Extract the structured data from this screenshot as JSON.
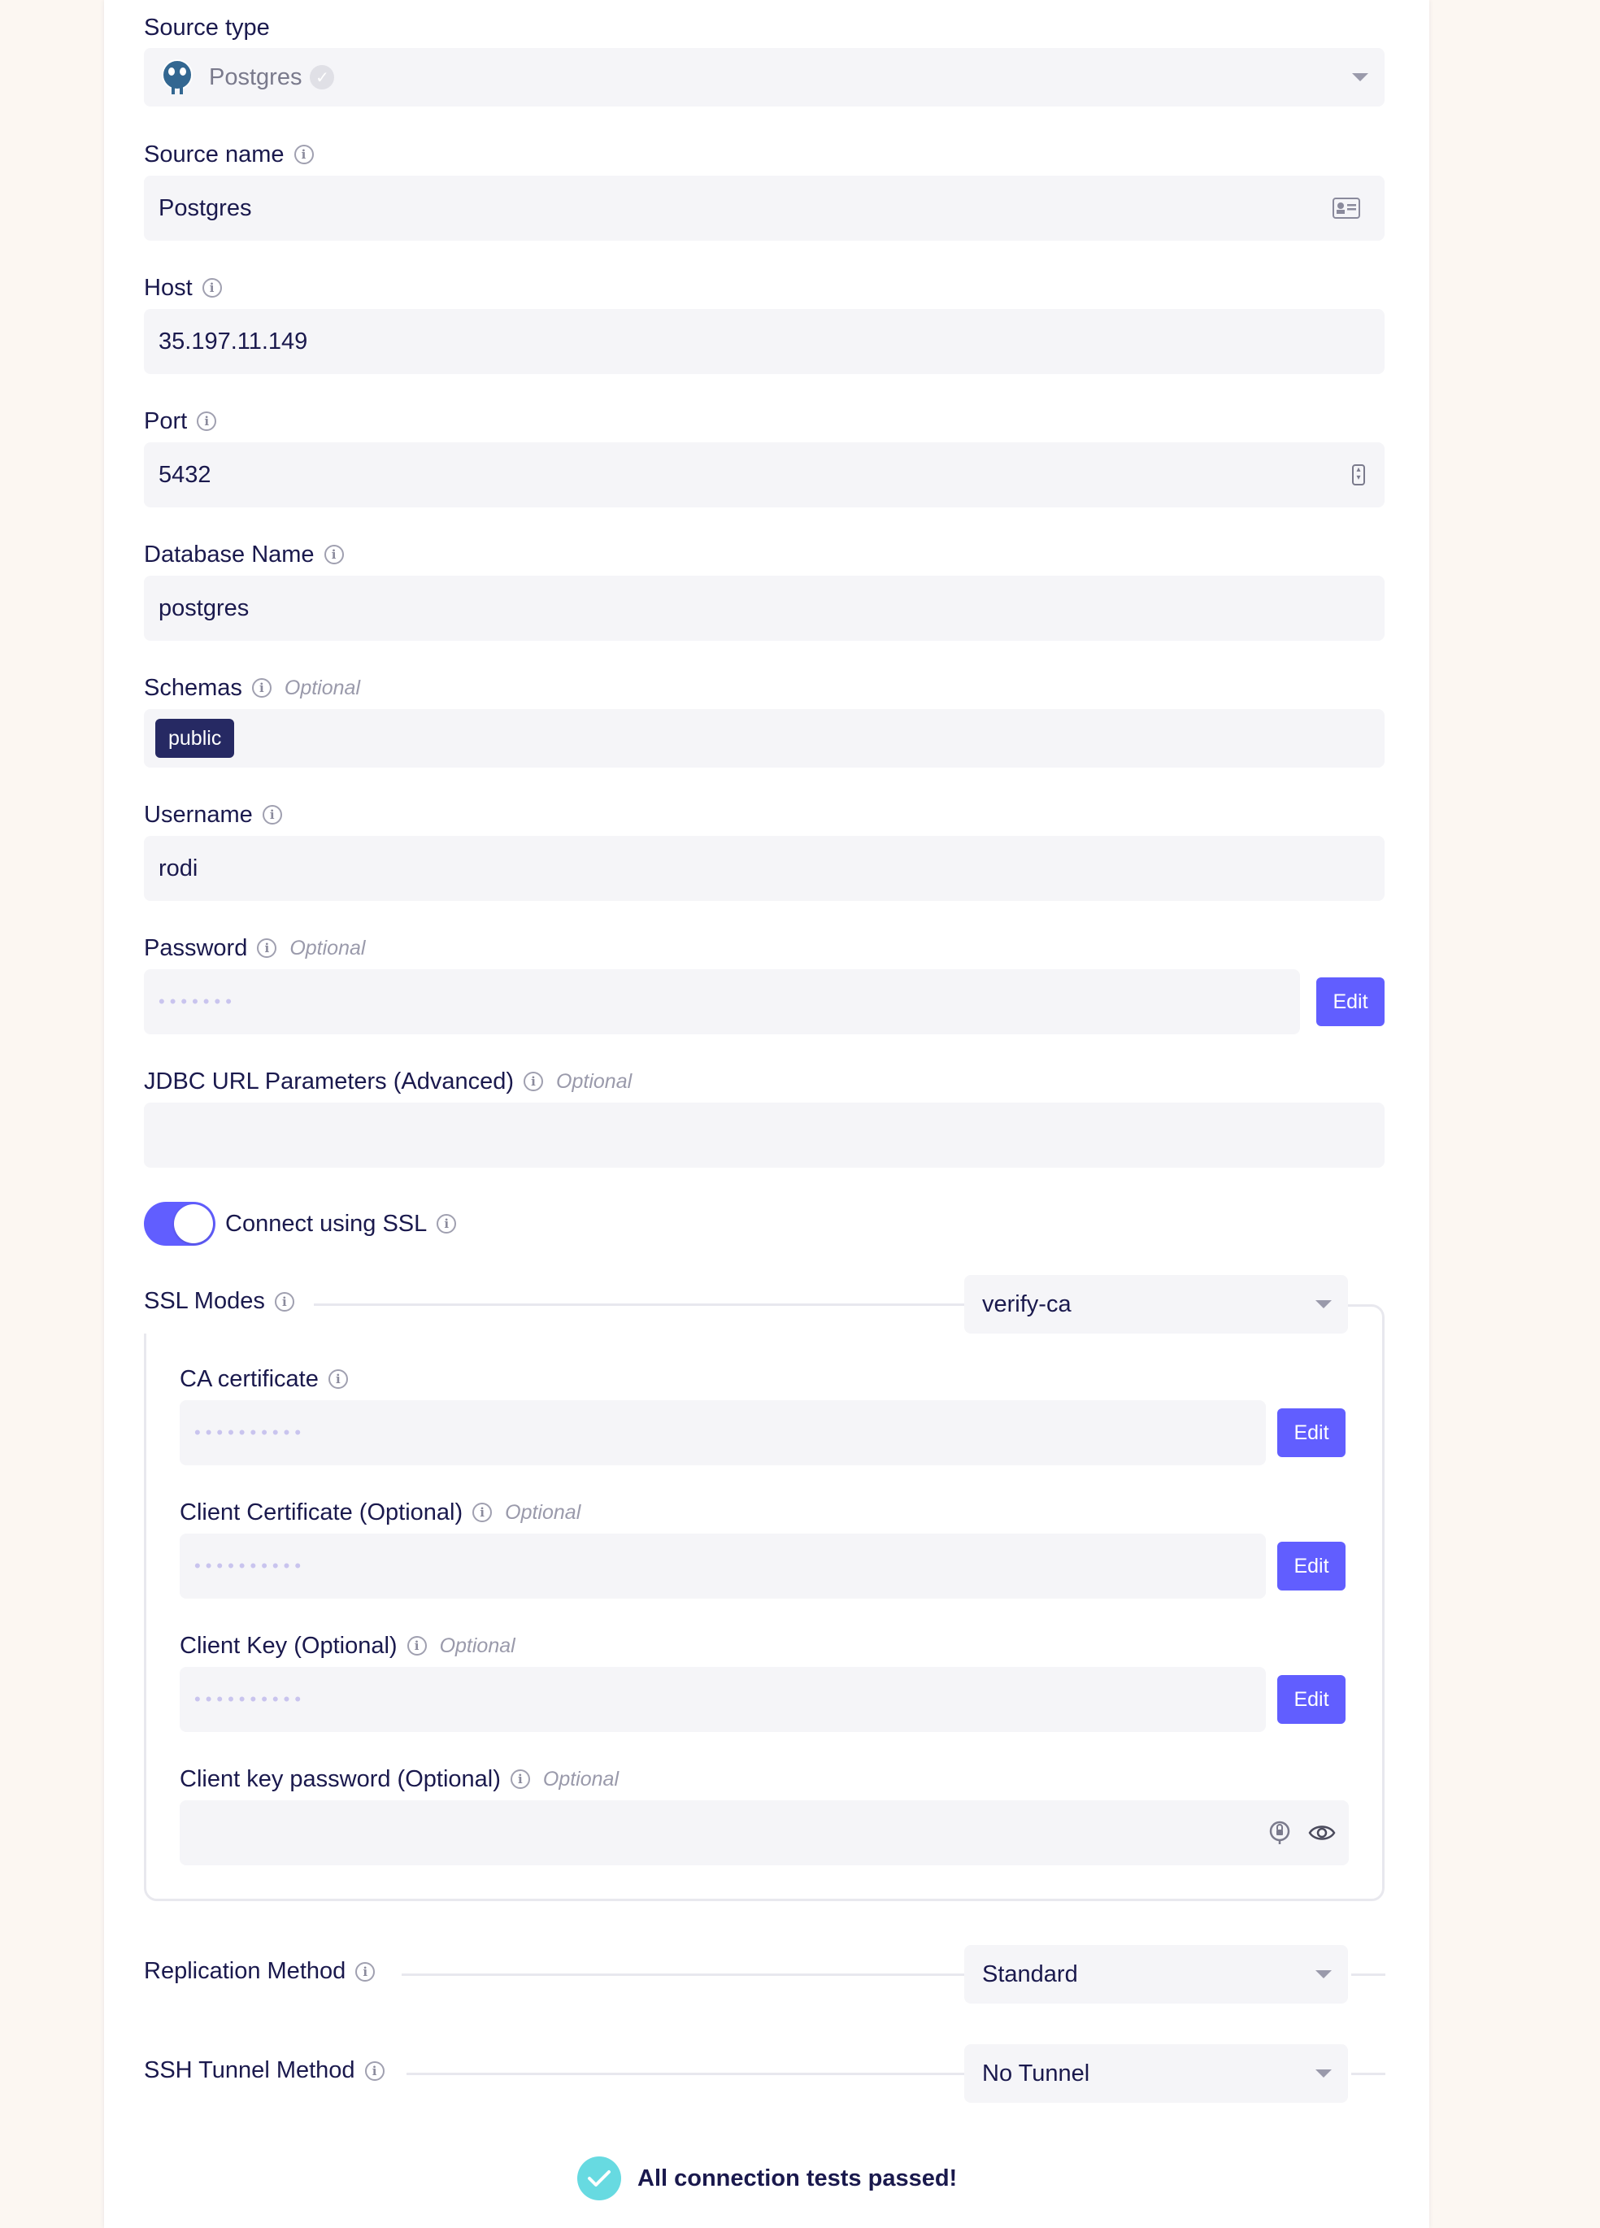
{
  "form": {
    "source_type": {
      "label": "Source type",
      "value": "Postgres"
    },
    "source_name": {
      "label": "Source name",
      "value": "Postgres"
    },
    "host": {
      "label": "Host",
      "value": "35.197.11.149"
    },
    "port": {
      "label": "Port",
      "value": "5432"
    },
    "database": {
      "label": "Database Name",
      "value": "postgres"
    },
    "schemas": {
      "label": "Schemas",
      "optional": "Optional",
      "chips": [
        "public"
      ]
    },
    "username": {
      "label": "Username",
      "value": "rodi"
    },
    "password": {
      "label": "Password",
      "optional": "Optional",
      "mask": "•••••••",
      "edit": "Edit"
    },
    "jdbc": {
      "label": "JDBC URL Parameters (Advanced)",
      "optional": "Optional",
      "value": ""
    },
    "ssl": {
      "label": "Connect using SSL",
      "enabled": true
    },
    "ssl_modes": {
      "label": "SSL Modes",
      "selected": "verify-ca",
      "ca_certificate": {
        "label": "CA certificate",
        "mask": "••••••••••",
        "edit": "Edit"
      },
      "client_certificate": {
        "label": "Client Certificate (Optional)",
        "optional": "Optional",
        "mask": "••••••••••",
        "edit": "Edit"
      },
      "client_key": {
        "label": "Client Key (Optional)",
        "optional": "Optional",
        "mask": "••••••••••",
        "edit": "Edit"
      },
      "client_key_password": {
        "label": "Client key password (Optional)",
        "optional": "Optional",
        "value": ""
      }
    },
    "replication": {
      "label": "Replication Method",
      "selected": "Standard"
    },
    "ssh_tunnel": {
      "label": "SSH Tunnel Method",
      "selected": "No Tunnel"
    },
    "status": {
      "text": "All connection tests passed!"
    }
  },
  "colors": {
    "accent": "#615eff",
    "chip": "#262963",
    "success": "#67dae1",
    "text": "#1a194d"
  }
}
